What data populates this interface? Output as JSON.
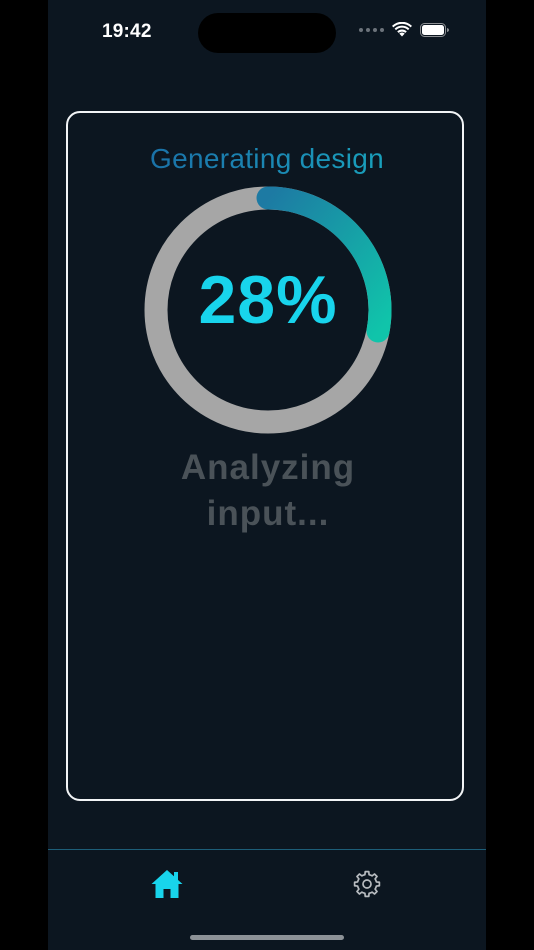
{
  "status_bar": {
    "time": "19:42"
  },
  "progress_card": {
    "title": "Generating design",
    "percent_label": "28%",
    "progress": 0.28,
    "status_message": "Analyzing input...",
    "colors": {
      "track": "#a6a6a6",
      "gradient_start": "#1d7aa3",
      "gradient_end": "#10c4aa",
      "percent_text": "#18d4ec",
      "status_text": "#4a5258"
    }
  },
  "tab_bar": {
    "tabs": [
      {
        "icon": "home-icon",
        "active": true,
        "color": "#18d4ec"
      },
      {
        "icon": "gear-icon",
        "active": false,
        "color": "#b8bcc0"
      }
    ]
  }
}
